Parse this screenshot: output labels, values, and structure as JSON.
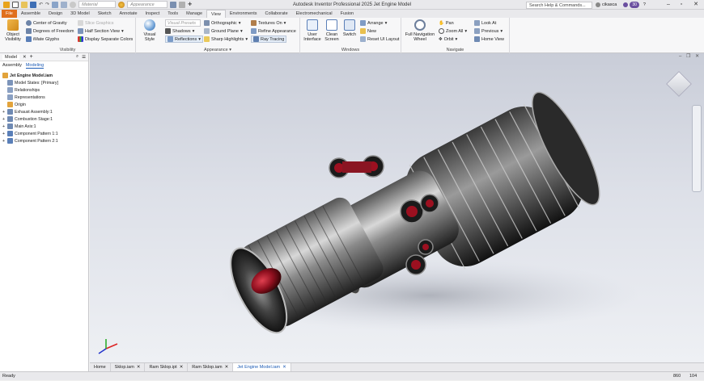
{
  "window": {
    "title": "Autodesk Inventor Professional 2025   Jet Engine Model",
    "search_placeholder": "Search Help & Commands...",
    "username": "cikasca",
    "badge": "30",
    "material_placeholder": "Material",
    "appearance_placeholder": "Appearance"
  },
  "menu_tabs": [
    "File",
    "Assemble",
    "Design",
    "3D Model",
    "Sketch",
    "Annotate",
    "Inspect",
    "Tools",
    "Manage",
    "View",
    "Environments",
    "Collaborate",
    "Electromechanical",
    "Fusion"
  ],
  "active_tab": "View",
  "ribbon": {
    "visibility": {
      "label": "Visibility",
      "object_visibility": "Object Visibility",
      "center_of_gravity": "Center of Gravity",
      "degrees_of_freedom": "Degrees of Freedom",
      "imate_glyphs": "iMate Glyphs",
      "slice_graphics": "Slice Graphics",
      "half_section_view": "Half Section View",
      "display_separate_colors": "Display Separate Colors"
    },
    "appearance": {
      "label": "Appearance",
      "visual_style": "Visual Style",
      "visual_presets": "Visual Presets",
      "shadows": "Shadows",
      "reflections": "Reflections",
      "orthographic": "Orthographic",
      "ground_plane": "Ground Plane",
      "sharp_highlights": "Sharp Highlights",
      "textures_on": "Textures On",
      "refine_appearance": "Refine Appearance",
      "ray_tracing": "Ray Tracing"
    },
    "windows": {
      "label": "Windows",
      "user_interface": "User Interface",
      "clean_screen": "Clean Screen",
      "switch": "Switch",
      "arrange": "Arrange",
      "new": "New",
      "reset_ui_layout": "Reset UI Layout"
    },
    "navigate": {
      "label": "Navigate",
      "full_navigation_wheel": "Full Navigation Wheel",
      "pan": "Pan",
      "zoom_all": "Zoom All",
      "orbit": "Orbit",
      "look_at": "Look At",
      "previous": "Previous",
      "home_view": "Home View"
    }
  },
  "browser": {
    "tab_model": "Model",
    "add": "+",
    "sub_assembly": "Assembly",
    "sub_modeling": "Modeling",
    "root": "Jet Engine Model.iam",
    "items": [
      "Model States: [Primary]",
      "Relationships",
      "Representations",
      "Origin",
      "Exhaust Assembly:1",
      "Combustion Stage:1",
      "Main Axis:1",
      "Component Pattern 1:1",
      "Component Pattern 2:1"
    ]
  },
  "doc_tabs": [
    {
      "label": "Home",
      "active": false
    },
    {
      "label": "Sklop.iam",
      "active": false
    },
    {
      "label": "Ram Sklop.ipt",
      "active": false
    },
    {
      "label": "Ram Sklop.iam",
      "active": false
    },
    {
      "label": "Jet Engine Model.iam",
      "active": true
    }
  ],
  "status": {
    "text": "Ready",
    "count1": "860",
    "count2": "104"
  },
  "colors": {
    "file_tab": "#e06f1d",
    "accent": "#1c5bb5",
    "badge": "#6b4fa0",
    "engine_red": "#9c1020"
  }
}
